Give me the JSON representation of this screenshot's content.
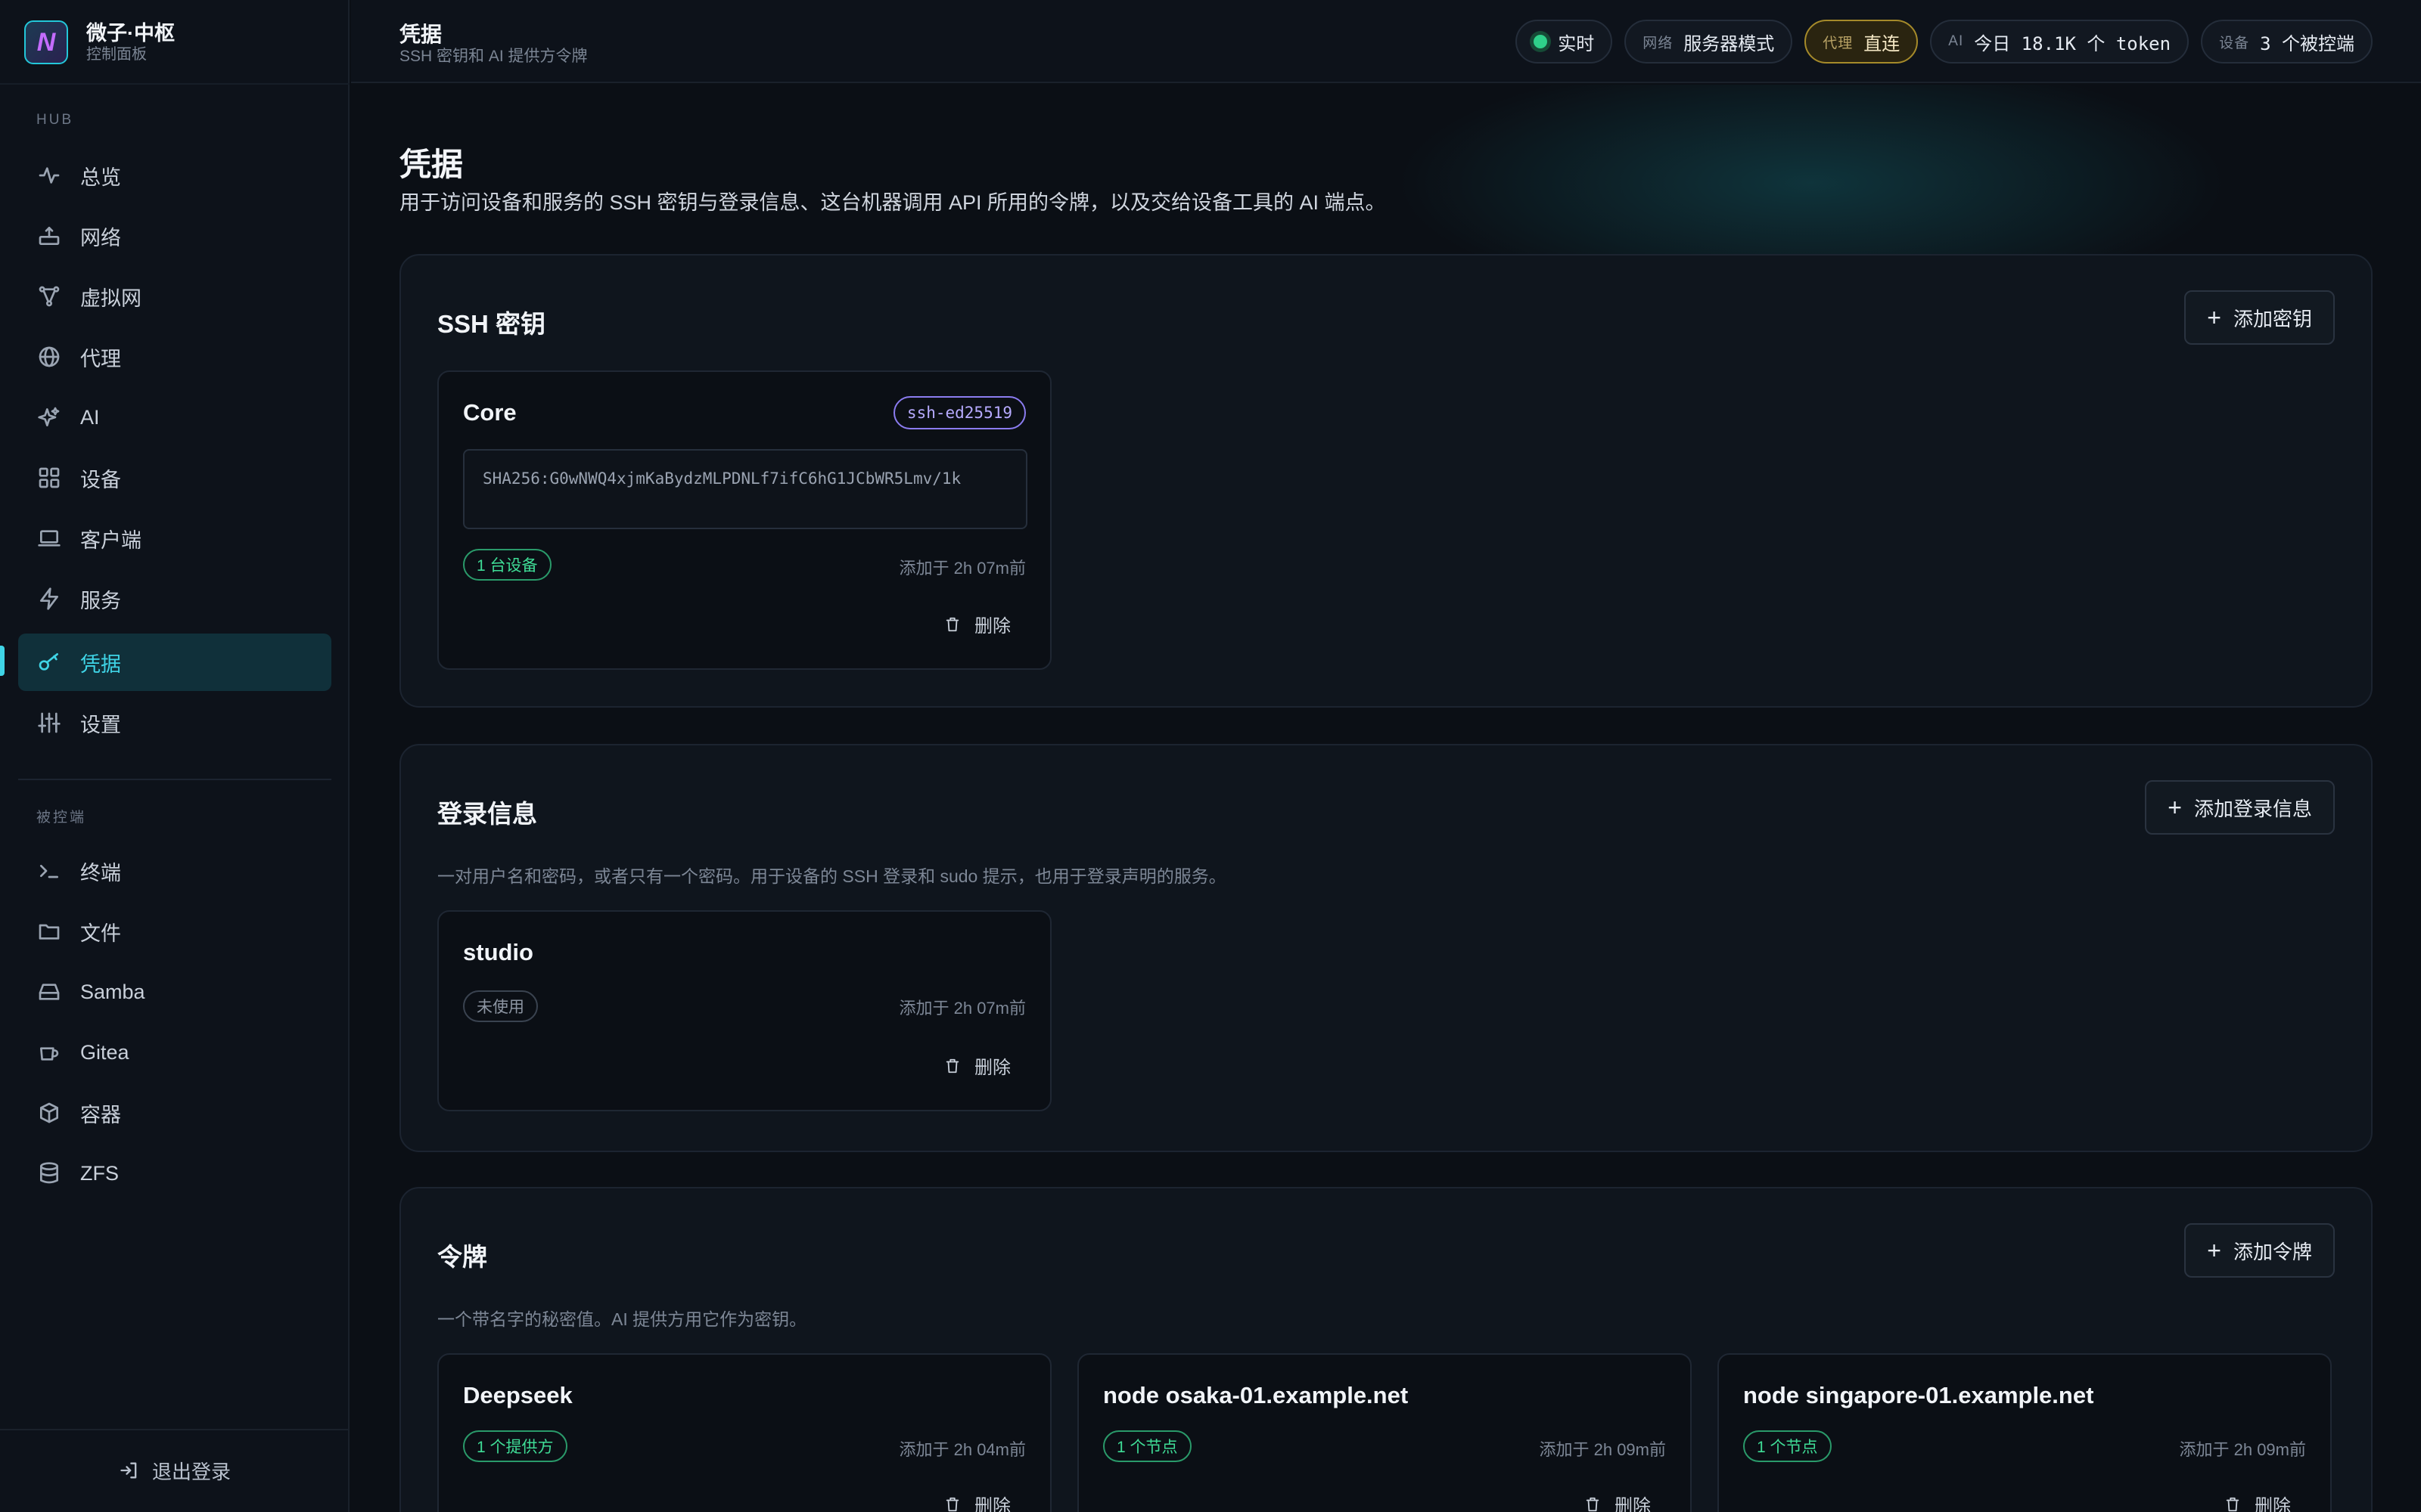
{
  "brand": {
    "logo_letter": "N",
    "title": "微子·中枢",
    "subtitle": "控制面板"
  },
  "sidebar": {
    "hub_label": "HUB",
    "hub_items": [
      {
        "label": "总览",
        "icon": "activity-icon"
      },
      {
        "label": "网络",
        "icon": "router-icon"
      },
      {
        "label": "虚拟网",
        "icon": "share-nodes-icon"
      },
      {
        "label": "代理",
        "icon": "globe-icon"
      },
      {
        "label": "AI",
        "icon": "sparkles-icon"
      },
      {
        "label": "设备",
        "icon": "grid-icon"
      },
      {
        "label": "客户端",
        "icon": "laptop-icon"
      },
      {
        "label": "服务",
        "icon": "bolt-icon"
      },
      {
        "label": "凭据",
        "icon": "key-icon",
        "active": true
      },
      {
        "label": "设置",
        "icon": "sliders-icon"
      }
    ],
    "managed_label": "被控端",
    "managed_items": [
      {
        "label": "终端",
        "icon": "terminal-icon"
      },
      {
        "label": "文件",
        "icon": "folder-icon"
      },
      {
        "label": "Samba",
        "icon": "hard-drive-icon"
      },
      {
        "label": "Gitea",
        "icon": "cup-icon"
      },
      {
        "label": "容器",
        "icon": "box-icon"
      },
      {
        "label": "ZFS",
        "icon": "database-icon"
      }
    ],
    "logout_label": "退出登录"
  },
  "topbar": {
    "title": "凭据",
    "subtitle": "SSH 密钥和 AI 提供方令牌",
    "status": {
      "label": "实时",
      "color": "#2fd08a"
    },
    "network": {
      "key": "网络",
      "value": "服务器模式"
    },
    "proxy": {
      "key": "代理",
      "value": "直连"
    },
    "ai": {
      "key": "AI",
      "value": "今日 18.1K 个 token"
    },
    "devices": {
      "key": "设备",
      "value": "3 个被控端"
    }
  },
  "page": {
    "title": "凭据",
    "description": "用于访问设备和服务的 SSH 密钥与登录信息、这台机器调用 API 所用的令牌，以及交给设备工具的 AI 端点。"
  },
  "ssh_keys": {
    "title": "SSH 密钥",
    "add_label": "添加密钥",
    "items": [
      {
        "name": "Core",
        "type": "ssh-ed25519",
        "fingerprint": "SHA256:G0wNWQ4xjmKaBydzMLPDNLf7ifC6hG1JCbWR5Lmv/1k",
        "usage": "1 台设备",
        "added": "添加于 2h 07m前",
        "delete_label": "删除"
      }
    ]
  },
  "logins": {
    "title": "登录信息",
    "add_label": "添加登录信息",
    "description": "一对用户名和密码，或者只有一个密码。用于设备的 SSH 登录和 sudo 提示，也用于登录声明的服务。",
    "items": [
      {
        "name": "studio",
        "usage": "未使用",
        "added": "添加于 2h 07m前",
        "delete_label": "删除"
      }
    ]
  },
  "tokens": {
    "title": "令牌",
    "add_label": "添加令牌",
    "description": "一个带名字的秘密值。AI 提供方用它作为密钥。",
    "items": [
      {
        "name": "Deepseek",
        "usage": "1 个提供方",
        "added": "添加于 2h 04m前",
        "delete_label": "删除"
      },
      {
        "name": "node osaka-01.example.net",
        "usage": "1 个节点",
        "added": "添加于 2h 09m前",
        "delete_label": "删除"
      },
      {
        "name": "node singapore-01.example.net",
        "usage": "1 个节点",
        "added": "添加于 2h 09m前",
        "delete_label": "删除"
      }
    ]
  },
  "colors": {
    "accent": "#3fd4e6",
    "success": "#3fdc96",
    "violet": "#b7abff",
    "warning": "#a58a2a"
  }
}
